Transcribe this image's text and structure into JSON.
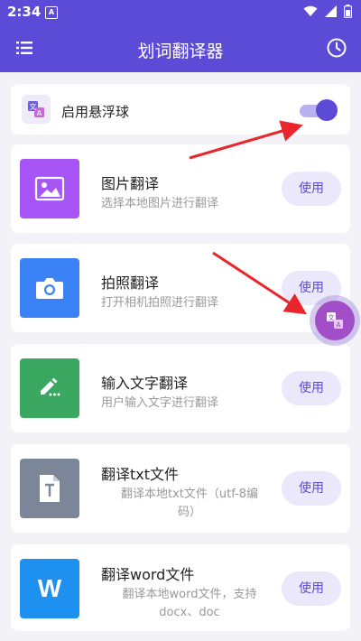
{
  "status_bar": {
    "time": "2:34",
    "notification_badge": "A"
  },
  "app_bar": {
    "title": "划词翻译器",
    "menu_icon": "menu-icon",
    "history_icon": "clock-icon"
  },
  "floating_toggle": {
    "label": "启用悬浮球",
    "enabled": true
  },
  "features": [
    {
      "title": "图片翻译",
      "description": "选择本地图片进行翻译",
      "button": "使用",
      "icon": "image-icon",
      "color": "#a855f7"
    },
    {
      "title": "拍照翻译",
      "description": "打开相机拍照进行翻译",
      "button": "使用",
      "icon": "camera-icon",
      "color": "#3b82f6"
    },
    {
      "title": "输入文字翻译",
      "description": "用户输入文字进行翻译",
      "button": "使用",
      "icon": "pencil-icon",
      "color": "#3aa860"
    },
    {
      "title": "翻译txt文件",
      "description_line1": "翻译本地txt文件（utf-8编",
      "description_line2": "码）",
      "button": "使用",
      "icon": "file-icon",
      "color": "#7b8799"
    },
    {
      "title": "翻译word文件",
      "description_line1": "翻译本地word文件，支持",
      "description_line2": "docx、doc",
      "button": "使用",
      "icon": "word-icon",
      "icon_letter": "W",
      "color": "#1e90f0"
    }
  ],
  "colors": {
    "primary": "#5b4bd6",
    "button_bg": "#ece8fb",
    "fab": "#a34ec9",
    "annotation_arrow": "#e8262b"
  }
}
